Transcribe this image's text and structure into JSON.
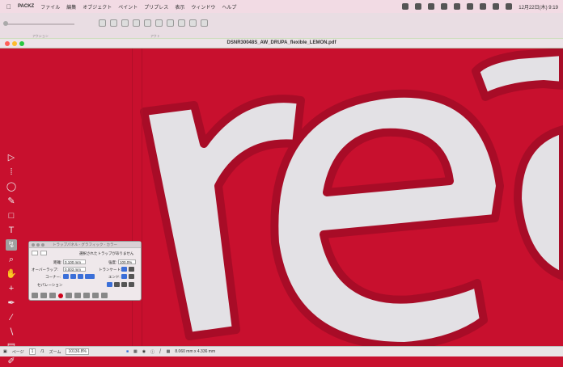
{
  "menubar": {
    "app": "PACKZ",
    "items": [
      "ファイル",
      "編集",
      "オブジェクト",
      "ペイント",
      "プリプレス",
      "表示",
      "ウィンドウ",
      "ヘルプ"
    ],
    "clock": "12月22日(木) 9:19"
  },
  "toolbar": {
    "left_label": "アクション",
    "right_label": "アクト"
  },
  "window": {
    "title": "DSNR30048S_AW_DRUPA_flexible_LEMON.pdf"
  },
  "canvas": {
    "artwork_text": "rea",
    "background_color": "#c8102e",
    "letter_fill": "#e3e1e5",
    "trap_outline": "#a80c27"
  },
  "trap_panel": {
    "title": "トラップパネル - グラフィック - カラー",
    "status": "選択されたトラップがありません",
    "distance_label": "距離:",
    "distance_value": "0.100 mm",
    "intensity_label": "強度:",
    "intensity_value": "100.0%",
    "overlap_label": "オーバーラップ:",
    "overlap_value": "0.003 mm",
    "truncate_label": "トランケート:",
    "corner_label": "コーナー:",
    "end_label": "エンド:",
    "separation_label": "セパレーション"
  },
  "statusbar": {
    "page_label": "ページ",
    "page_value": "1",
    "page_total": "/1",
    "zoom_label": "ズーム",
    "zoom_value": "10136.8%",
    "dimensions": "8.060 mm x 4.336 mm"
  }
}
